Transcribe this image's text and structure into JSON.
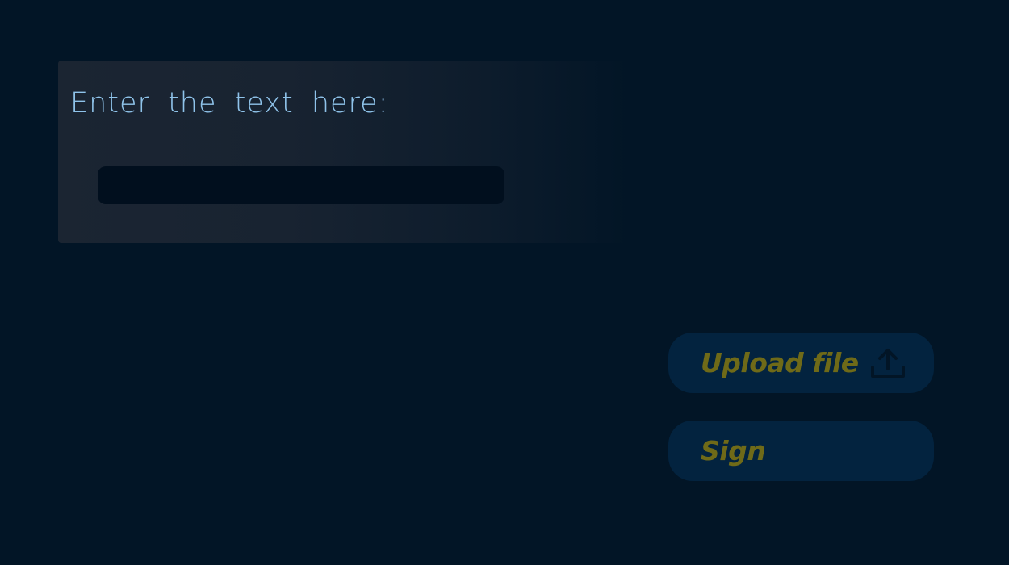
{
  "form": {
    "prompt_label": "Enter the text here:",
    "text_value": "",
    "text_placeholder": ""
  },
  "actions": {
    "upload_label": "Upload file",
    "upload_icon": "upload-icon",
    "sign_label": "Sign"
  },
  "colors": {
    "background": "#021526",
    "panel": "#1b2532",
    "input": "#010f1e",
    "label_text": "#8fc3ea",
    "button_bg": "#03233f",
    "button_text": "#6f6a18",
    "icon": "#021526"
  }
}
